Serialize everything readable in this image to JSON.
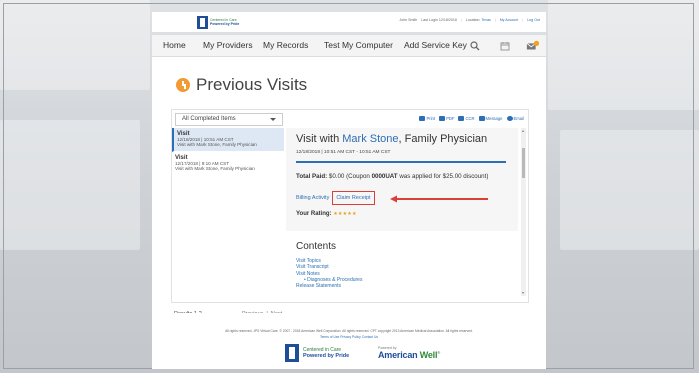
{
  "header": {
    "logo": {
      "line1": "Centered in Care",
      "line2": "Powered by Pride"
    },
    "user": "John Smith",
    "last_login": "Last Login 12/18/2018",
    "location_label": "Location:",
    "location_value": "Texas",
    "my_account": "My Account",
    "logout": "Log Out"
  },
  "nav": {
    "home": "Home",
    "providers": "My Providers",
    "records": "My Records",
    "test": "Test My Computer",
    "service_key": "Add Service Key",
    "search_icon": "search-icon",
    "calendar_icon": "calendar-icon",
    "mail_icon": "mail-icon",
    "mail_badge_color": "#f3a21b"
  },
  "page": {
    "title": "Previous Visits"
  },
  "filter": {
    "selected": "All Completed Items"
  },
  "actions": {
    "print": "Print",
    "pdf": "PDF",
    "ccr": "CCR",
    "message": "Message",
    "email": "Email"
  },
  "visits": [
    {
      "title": "Visit",
      "datetime": "12/18/2018 | 10:51 AM CST",
      "desc": "Visit with Mark Stone, Family Physician"
    },
    {
      "title": "Visit",
      "datetime": "12/17/2018 | 9:10 AM CST",
      "desc": "Visit with Mark Stone, Family Physician"
    }
  ],
  "detail": {
    "title_prefix": "Visit with",
    "doctor": "Mark Stone",
    "title_suffix": ", Family Physician",
    "datetime": "12/18/2018 | 10:51 AM CST - 10:51 AM CST",
    "paid_label": "Total Paid:",
    "paid_text_a": " $0.00 (Coupon ",
    "coupon": "0000UAT",
    "paid_text_b": " was applied for $25.00 discount)",
    "billing_link": "Billing Activity",
    "claim_link": "Claim Receipt",
    "rating_label": "Your Rating:",
    "rating_stars": "★★★★★",
    "highlight_color": "#d9403a"
  },
  "contents": {
    "title": "Contents",
    "items": [
      "Visit Topics",
      "Visit Transcript",
      "Visit Notes"
    ],
    "sub_item": "•  Diagnoses & Procedures",
    "last_item": "Release Statements"
  },
  "footer_bar": {
    "results": "Results 1-2",
    "previous": "Previous",
    "separator": "|",
    "next": "Next"
  },
  "footer": {
    "line1": "All rights reserved. JPS Virtual Care.   © 2007 - 2018 American Well Corporation. All rights reserved.   CPT copyright 2013 American Medical Association. All rights reserved.",
    "line2": "Terms of Use   Privacy Policy   Contact Us",
    "logo_line1": "Centered in Care",
    "logo_line2": "Powered by Pride",
    "aw_powered": "Powered by",
    "aw_name_a": "American",
    "aw_name_b": "Well",
    "aw_mark": "®"
  }
}
